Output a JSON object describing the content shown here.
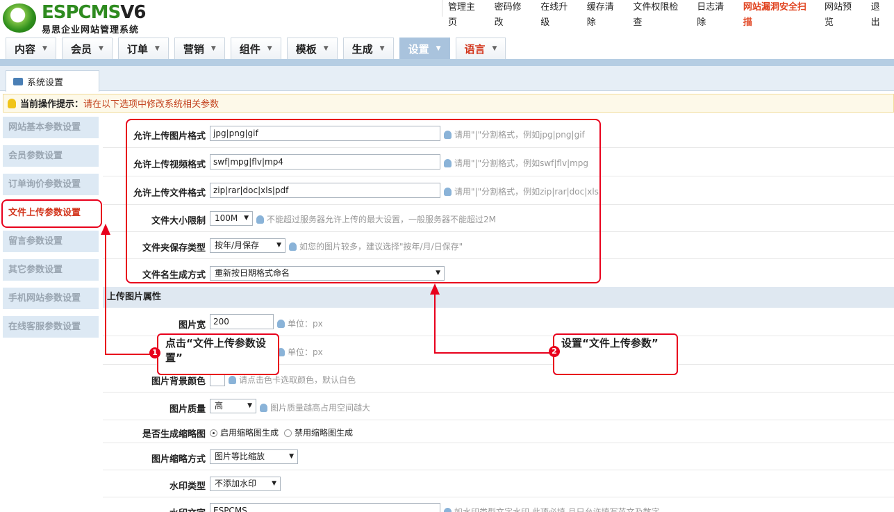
{
  "header": {
    "logo_text": "ESPCMS",
    "logo_version": "V6",
    "logo_subtitle": "易思企业网站管理系统",
    "top_links": [
      "管理主页",
      "密码修改",
      "在线升级",
      "缓存清除",
      "文件权限检查",
      "日志清除",
      "网站漏洞安全扫描",
      "网站预览",
      "退出"
    ]
  },
  "nav": {
    "tabs": [
      "内容",
      "会员",
      "订单",
      "营销",
      "组件",
      "模板",
      "生成",
      "设置",
      "语言"
    ],
    "active": "设置"
  },
  "subtab": {
    "label": "系统设置"
  },
  "tip": {
    "label": "当前操作提示：",
    "text": "请在以下选项中修改系统相关参数"
  },
  "sidebar": {
    "items": [
      "网站基本参数设置",
      "会员参数设置",
      "订单询价参数设置",
      "文件上传参数设置",
      "留言参数设置",
      "其它参数设置",
      "手机网站参数设置",
      "在线客服参数设置"
    ],
    "active_index": 3
  },
  "upload_settings": {
    "image_formats": {
      "label": "允许上传图片格式",
      "value": "jpg|png|gif",
      "hint": "请用\"|\"分割格式，例如jpg|png|gif"
    },
    "video_formats": {
      "label": "允许上传视频格式",
      "value": "swf|mpg|flv|mp4",
      "hint": "请用\"|\"分割格式，例如swf|flv|mpg"
    },
    "file_formats": {
      "label": "允许上传文件格式",
      "value": "zip|rar|doc|xls|pdf",
      "hint": "请用\"|\"分割格式，例如zip|rar|doc|xls"
    },
    "size_limit": {
      "label": "文件大小限制",
      "value": "100M",
      "hint": "不能超过服务器允许上传的最大设置，一般服务器不能超过2M"
    },
    "folder_type": {
      "label": "文件夹保存类型",
      "value": "按年/月保存",
      "hint": "如您的图片较多，建议选择\"按年/月/日保存\""
    },
    "naming": {
      "label": "文件名生成方式",
      "value": "重新按日期格式命名"
    }
  },
  "image_section": {
    "title": "上传图片属性"
  },
  "image_settings": {
    "width": {
      "label": "图片宽",
      "value": "200",
      "hint": "单位：px"
    },
    "height": {
      "hint": "单位：px"
    },
    "bg_color": {
      "label": "图片背景颜色",
      "hint": "请点击色卡选取颜色，默认白色"
    },
    "quality": {
      "label": "图片质量",
      "value": "高",
      "hint": "图片质量越高占用空间越大"
    },
    "thumb": {
      "label": "是否生成缩略图",
      "option_on": "启用缩略图生成",
      "option_off": "禁用缩略图生成"
    },
    "thumb_mode": {
      "label": "图片缩略方式",
      "value": "图片等比缩放"
    },
    "watermark_type": {
      "label": "水印类型",
      "value": "不添加水印"
    },
    "watermark_text": {
      "label": "水印文字",
      "value": "ESPCMS",
      "hint": "如水印类型文字水印,此项必填,且只允许填写英文及数字"
    }
  },
  "annotations": {
    "callout1": {
      "number": "1",
      "text": "点击“文件上传参数设置”"
    },
    "callout2": {
      "number": "2",
      "text": "设置“文件上传参数”"
    }
  },
  "colors": {
    "accent_red": "#e8001c",
    "nav_active": "#a9c3dd",
    "brand_green": "#2e8b1f"
  }
}
